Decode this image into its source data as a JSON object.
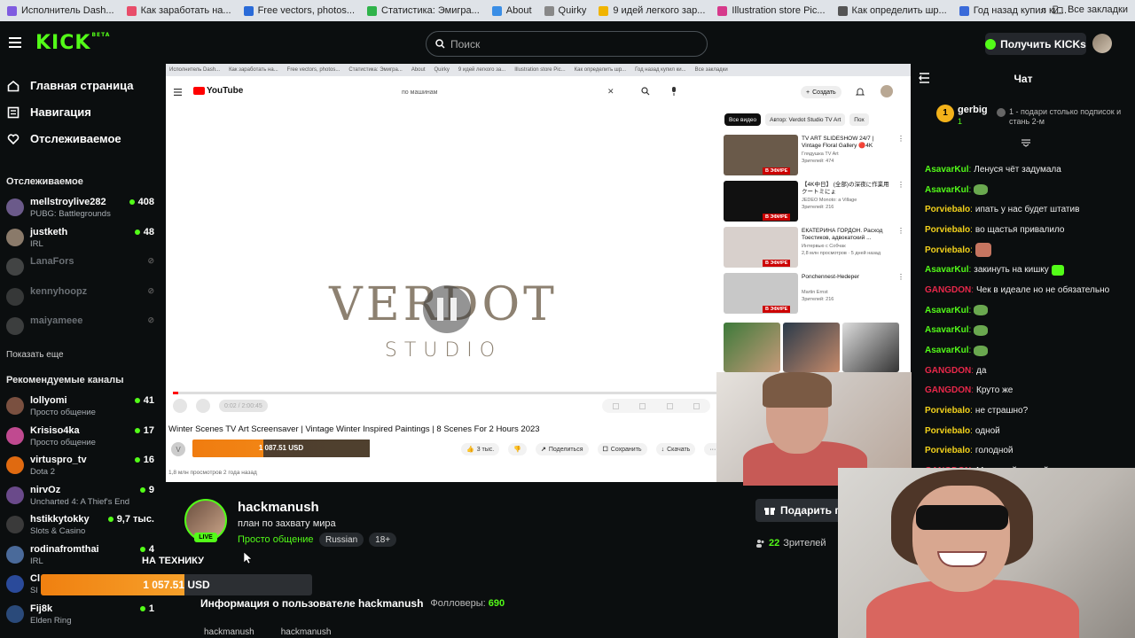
{
  "bookmarks": [
    {
      "label": "Исполнитель Dash...",
      "color": "#7f5be0"
    },
    {
      "label": "Как заработать на...",
      "color": "#e84d6a"
    },
    {
      "label": "Free vectors, photos...",
      "color": "#2a6bd8"
    },
    {
      "label": "Статистика: Эмигра...",
      "color": "#2fb34a"
    },
    {
      "label": "About",
      "color": "#3a8ee6"
    },
    {
      "label": "Quirky",
      "color": "#888888"
    },
    {
      "label": "9 идей легкого зар...",
      "color": "#f0b400"
    },
    {
      "label": "Illustration store Pic...",
      "color": "#d63a8b"
    },
    {
      "label": "Как определить шр...",
      "color": "#555555"
    },
    {
      "label": "Год назад купил ки...",
      "color": "#3a6ad9"
    }
  ],
  "bookmarks_more": "»",
  "bookmarks_all": "Все закладки",
  "header": {
    "logo": "KICK",
    "logo_sup": "BETA",
    "search_placeholder": "Поиск",
    "get_kicks": "Получить KICKs"
  },
  "nav": [
    {
      "label": "Главная страница",
      "icon": "home-icon"
    },
    {
      "label": "Навигация",
      "icon": "compass-icon"
    },
    {
      "label": "Отслеживаемое",
      "icon": "heart-icon"
    }
  ],
  "following_title": "Отслеживаемое",
  "following": [
    {
      "name": "mellstroylive282",
      "sub": "PUBG: Battlegrounds",
      "viewers": "408",
      "online": true,
      "color": "#6b5a8a"
    },
    {
      "name": "justketh",
      "sub": "IRL",
      "viewers": "48",
      "online": true,
      "color": "#8a7a6a"
    },
    {
      "name": "LanaFors",
      "sub": "",
      "viewers": "",
      "online": false,
      "color": "#aaaaaa"
    },
    {
      "name": "kennyhoopz",
      "sub": "",
      "viewers": "",
      "online": false,
      "color": "#888888"
    },
    {
      "name": "maiyameee",
      "sub": "",
      "viewers": "",
      "online": false,
      "color": "#999999"
    }
  ],
  "show_more": "Показать еще",
  "recommended_title": "Рекомендуемые каналы",
  "recommended": [
    {
      "name": "lollyomi",
      "sub": "Просто общение",
      "viewers": "41",
      "color": "#7a5040"
    },
    {
      "name": "Krisiso4ka",
      "sub": "Просто общение",
      "viewers": "17",
      "color": "#c04a90"
    },
    {
      "name": "virtuspro_tv",
      "sub": "Dota 2",
      "viewers": "16",
      "color": "#e06a10"
    },
    {
      "name": "nirvOz",
      "sub": "Uncharted 4: A Thief's End",
      "viewers": "9",
      "color": "#6a4a8a"
    },
    {
      "name": "hstikkytokky",
      "sub": "Slots & Casino",
      "viewers": "9,7 тыс.",
      "color": "#3a3a3a"
    },
    {
      "name": "rodinafromthai",
      "sub": "IRL",
      "viewers": "4",
      "color": "#4a6a9a"
    },
    {
      "name": "Cl",
      "sub": "Sl",
      "viewers": "",
      "color": "#2a4a9a"
    },
    {
      "name": "Fij8k",
      "sub": "Elden Ring",
      "viewers": "1",
      "color": "#2a4a7a"
    }
  ],
  "youtube": {
    "bookmarks": [
      "Исполнитель Dash...",
      "Как заработать на...",
      "Free vectors, photos...",
      "Статистика: Эмигра...",
      "About",
      "Quirky",
      "9 идей легкого за...",
      "Illustration store Pic...",
      "Как определить шр...",
      "Год назад купил ки...",
      "Все закладки"
    ],
    "logo": "YouTube",
    "search_value": "по машинам",
    "create_label": "Создать",
    "player_brand": "VERDOT",
    "player_brand_sub": "STUDIO",
    "progress": 0.01,
    "time": "0:02 / 2:00:45",
    "title": "Winter Scenes TV Art Screensaver | Vintage Winter Inspired Paintings | 8 Scenes For 2 Hours 2023",
    "channel_initial": "V",
    "donation": "1 087.51 USD",
    "actions": [
      "3 тыс.",
      "Поделиться",
      "Сохранить",
      "Скачать"
    ],
    "meta": "1,8 млн просмотров  2 года назад",
    "chips": [
      "Все видео",
      "Автор: Verdot Studio TV Art",
      "Пох"
    ],
    "recs": [
      {
        "title": "TV ART SLIDESHOW 24/7 | Vintage Floral Gallery 🔴4K",
        "channel": "Глядушка TV Art",
        "extra": "Зрителей: 474",
        "color": "#6a5a4a"
      },
      {
        "title": "【4K中日】 (全部)の深夜に作業用 クートミにょ  ",
        "channel": "JEDEO Monoto: a Village",
        "extra": "Зрителей: 216",
        "color": "#111111"
      },
      {
        "title": "ЕКАТЕРИНА ГОРДОН. Расход Тоестиков, адвокатский ...",
        "channel": "Интервью с Собчак",
        "extra": "2,8 млн просмотров · 5 дней назад",
        "color": "#d8d0cc"
      },
      {
        "title": "Ponchennest-Hedeper",
        "channel": "Martin Ernst",
        "extra": "Зрителей: 216",
        "color": "#c8c8c8"
      }
    ],
    "live_label": "В ЭФИРЕ"
  },
  "channel": {
    "name": "hackmanush",
    "title": "план по захвату мира",
    "category": "Просто общение",
    "tags": [
      "Russian",
      "18+"
    ],
    "live": "LIVE",
    "gift": "Подарить п",
    "viewers_count": "22",
    "viewers_label": "Зрителей",
    "tech_label": "НА ТЕХНИКУ",
    "donation": "1 057.51 USD",
    "donation_progress": 0.53,
    "about": "Информация о пользователе hackmanush",
    "followers_label": "Фолловеры:",
    "followers": "690",
    "links": [
      "hackmanush",
      "hackmanush"
    ]
  },
  "chat": {
    "title": "Чат",
    "pinned_user": "gerbig",
    "pinned_rank": "1",
    "pinned_count": "1",
    "pinned_text": "1 - подари столько подписок и стань 2-м",
    "messages": [
      {
        "user": "AsavarKul",
        "text": "Ленуся чёт задумала",
        "color": "#53fc18",
        "emote": ""
      },
      {
        "user": "AsavarKul",
        "text": "",
        "color": "#53fc18",
        "emote": "pepe"
      },
      {
        "user": "Porviebalo",
        "text": "ипать у нас будет штатив",
        "color": "#f3d21c",
        "emote": ""
      },
      {
        "user": "Porviebalo",
        "text": "во щастья привалило",
        "color": "#f3d21c",
        "emote": ""
      },
      {
        "user": "Porviebalo",
        "text": "",
        "color": "#f3d21c",
        "emote": "face"
      },
      {
        "user": "AsavarKul",
        "text": "закинуть на кишку",
        "color": "#53fc18",
        "emote": "sq"
      },
      {
        "user": "GANGDON",
        "text": "Чек в идеале но не обязательно",
        "color": "#e8284a",
        "emote": ""
      },
      {
        "user": "AsavarKul",
        "text": "",
        "color": "#53fc18",
        "emote": "pepe"
      },
      {
        "user": "AsavarKul",
        "text": "",
        "color": "#53fc18",
        "emote": "pepe"
      },
      {
        "user": "AsavarKul",
        "text": "",
        "color": "#53fc18",
        "emote": "pepe"
      },
      {
        "user": "GANGDON",
        "text": "да",
        "color": "#e8284a",
        "emote": ""
      },
      {
        "user": "GANGDON",
        "text": "Круто же",
        "color": "#e8284a",
        "emote": ""
      },
      {
        "user": "Porviebalo",
        "text": "не страшно?",
        "color": "#f3d21c",
        "emote": ""
      },
      {
        "user": "Porviebalo",
        "text": "одной",
        "color": "#f3d21c",
        "emote": ""
      },
      {
        "user": "Porviebalo",
        "text": "голодной",
        "color": "#f3d21c",
        "emote": ""
      },
      {
        "user": "GANGDON",
        "text": "Мелстрой плохой пример",
        "color": "#e8284a",
        "emote": ""
      }
    ]
  },
  "colors": {
    "accent": "#53fc18",
    "bg": "#0b0e0f",
    "donation": "#f08010"
  }
}
